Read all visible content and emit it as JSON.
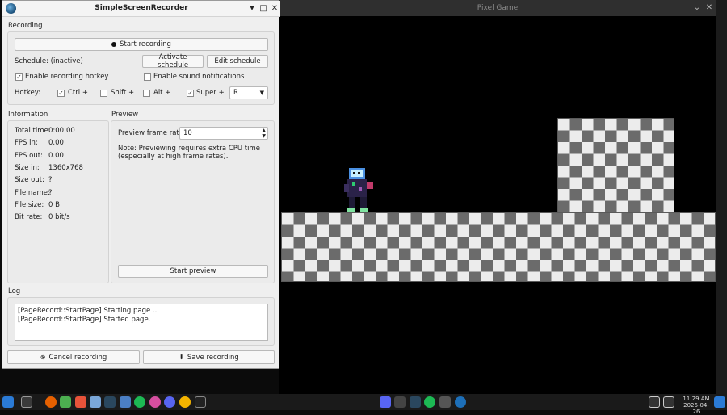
{
  "game_window": {
    "title": "Pixel Game",
    "minimize": "⌄",
    "close": "✕"
  },
  "ssr": {
    "title": "SimpleScreenRecorder",
    "controls": {
      "minimize": "▾",
      "maximize": "□",
      "close": "✕"
    },
    "recording": {
      "group_label": "Recording",
      "start_button": "Start recording",
      "schedule_label": "Schedule: (inactive)",
      "activate_schedule": "Activate schedule",
      "edit_schedule": "Edit schedule",
      "enable_hotkey": "Enable recording hotkey",
      "enable_hotkey_checked": true,
      "enable_sound": "Enable sound notifications",
      "enable_sound_checked": false,
      "hotkey_label": "Hotkey:",
      "ctrl": "Ctrl +",
      "ctrl_checked": true,
      "shift": "Shift +",
      "shift_checked": false,
      "alt": "Alt +",
      "alt_checked": false,
      "super": "Super +",
      "super_checked": true,
      "key_value": "R"
    },
    "information": {
      "group_label": "Information",
      "rows": [
        {
          "label": "Total time:",
          "value": "0:00:00"
        },
        {
          "label": "FPS in:",
          "value": "0.00"
        },
        {
          "label": "FPS out:",
          "value": "0.00"
        },
        {
          "label": "Size in:",
          "value": "1360x768"
        },
        {
          "label": "Size out:",
          "value": "?"
        },
        {
          "label": "File name:",
          "value": "?"
        },
        {
          "label": "File size:",
          "value": "0 B"
        },
        {
          "label": "Bit rate:",
          "value": "0 bit/s"
        }
      ]
    },
    "preview": {
      "group_label": "Preview",
      "frame_rate_label": "Preview frame rate:",
      "frame_rate_value": "10",
      "note": "Note: Previewing requires extra CPU time (especially at high frame rates).",
      "start_preview": "Start preview"
    },
    "log": {
      "group_label": "Log",
      "lines": [
        "[PageRecord::StartPage] Starting page ...",
        "[PageRecord::StartPage] Started page."
      ]
    },
    "bottom": {
      "cancel": "Cancel recording",
      "save": "Save recording"
    }
  },
  "taskbar": {
    "time": "11:29 AM",
    "date": "2026-04-26",
    "left_icons": [
      "start-icon",
      "files-icon",
      "firefox-icon",
      "minecraft-icon",
      "html-icon",
      "gdevelop-icon",
      "steam-icon",
      "games-icon",
      "spotify-icon",
      "krita-icon",
      "discord-icon",
      "chrome-icon",
      "terminal-icon"
    ],
    "tray_icons": [
      "discord-tray-icon",
      "cat-tray-icon",
      "steam-tray-icon",
      "spotify-tray-icon",
      "network-tray-icon",
      "ssr-tray-icon"
    ]
  },
  "colors": {
    "accent": "#1d6fb8",
    "checker_dark": "#6b6b6b",
    "checker_light": "#ececec"
  }
}
